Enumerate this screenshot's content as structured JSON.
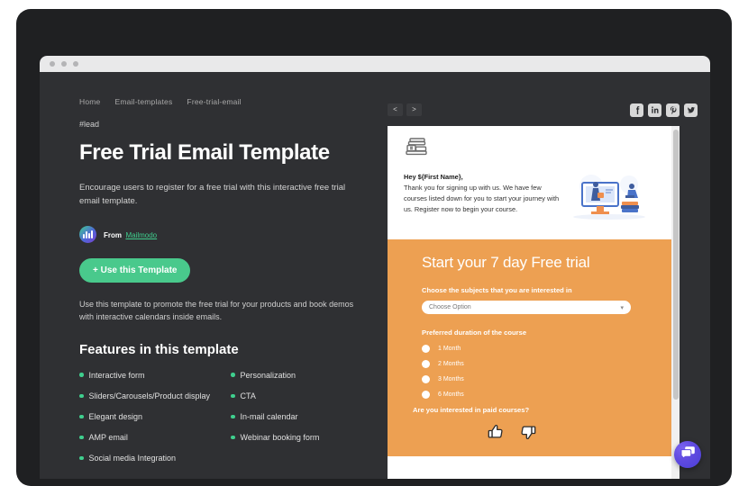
{
  "window": {
    "dots": [
      "dot-1",
      "dot-2",
      "dot-3"
    ]
  },
  "breadcrumb": [
    {
      "label": "Home"
    },
    {
      "label": "Email-templates"
    },
    {
      "label": "Free-trial-email"
    }
  ],
  "page": {
    "tag": "#lead",
    "title": "Free Trial Email Template",
    "description": "Encourage users to register for a free trial with this interactive free trial email template.",
    "promo": "Use this template to promote the free trial for your products and book demos with interactive calendars inside emails.",
    "features_heading": "Features in this template"
  },
  "from": {
    "label": "From",
    "name": "Mailmodo",
    "logo_icon": "mailmodo-logo-icon"
  },
  "cta": {
    "use_template_label": "+ Use this Template"
  },
  "features": {
    "column_left": [
      "Interactive form",
      "Sliders/Carousels/Product display",
      "Elegant design",
      "AMP email",
      "Social media Integration"
    ],
    "column_right": [
      "Personalization",
      "CTA",
      "In-mail calendar",
      "Webinar booking form"
    ]
  },
  "preview_toolbar": {
    "prev_label": "<",
    "next_label": ">",
    "social": [
      {
        "name": "facebook-icon"
      },
      {
        "name": "linkedin-icon"
      },
      {
        "name": "pinterest-icon"
      },
      {
        "name": "twitter-icon"
      }
    ]
  },
  "email": {
    "logo_icon": "stacked-books-icon",
    "greeting": "Hey ${First Name},",
    "body": "Thank you for signing up with us. We have few courses listed down for you to start your journey with us. Register now to begin your course.",
    "hero_icon": "online-learning-illustration",
    "orange_title": "Start your 7 day Free trial",
    "subjects_label": "Choose the subjects that you are interested in",
    "subjects_placeholder": "Choose Option",
    "duration_label": "Preferred duration of the course",
    "durations": [
      "1 Month",
      "2 Months",
      "3 Months",
      "6 Months"
    ],
    "paid_question": "Are you interested in paid courses?",
    "thumbs": [
      {
        "name": "thumbs-up-icon"
      },
      {
        "name": "thumbs-down-icon"
      }
    ]
  },
  "chat": {
    "icon": "chat-bubble-icon"
  },
  "colors": {
    "accent_green": "#49c98c",
    "orange_panel": "#eda052",
    "dark_bg": "#2f3033",
    "chat_purple": "#5f4ae0"
  }
}
